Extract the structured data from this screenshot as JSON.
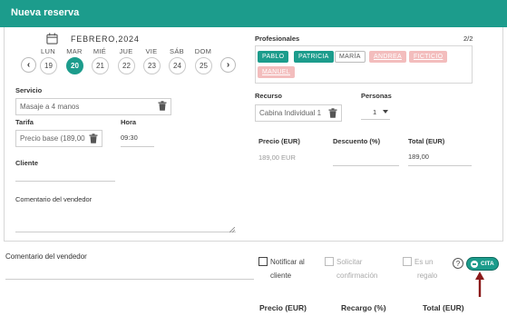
{
  "header": {
    "title": "Nueva reserva"
  },
  "calendar": {
    "month": "FEBRERO,2024",
    "prev": "‹",
    "next": "›",
    "days": [
      {
        "dow": "LUN",
        "num": "19",
        "selected": false
      },
      {
        "dow": "MAR",
        "num": "20",
        "selected": true
      },
      {
        "dow": "MIÉ",
        "num": "21",
        "selected": false
      },
      {
        "dow": "JUE",
        "num": "22",
        "selected": false
      },
      {
        "dow": "VIE",
        "num": "23",
        "selected": false
      },
      {
        "dow": "SÁB",
        "num": "24",
        "selected": false
      },
      {
        "dow": "DOM",
        "num": "25",
        "selected": false
      }
    ]
  },
  "form": {
    "servicio_label": "Servicio",
    "servicio_value": "Masaje a 4 manos",
    "tarifa_label": "Tarifa",
    "tarifa_value": "Precio base (189,00",
    "hora_label": "Hora",
    "hora_value": "09:30",
    "cliente_label": "Cliente",
    "comentario_label": "Comentario del vendedor"
  },
  "profesionales": {
    "label": "Profesionales",
    "count": "2/2",
    "chips": [
      {
        "name": "PABLO",
        "state": "on"
      },
      {
        "name": "PATRICIA",
        "state": "on"
      },
      {
        "name": "MARÍA",
        "state": "off"
      },
      {
        "name": "ANDREA",
        "state": "pink"
      },
      {
        "name": "FICTICIO",
        "state": "pink"
      },
      {
        "name": "MANUEL",
        "state": "pink"
      }
    ]
  },
  "recurso": {
    "label": "Recurso",
    "value": "Cabina Individual 1"
  },
  "personas": {
    "label": "Personas",
    "value": "1"
  },
  "pricing": {
    "precio_label": "Precio (EUR)",
    "precio_value": "189,00 EUR",
    "descuento_label": "Descuento (%)",
    "total_label": "Total (EUR)",
    "total_value": "189,00"
  },
  "bottom": {
    "comentario_label": "Comentario del vendedor",
    "notificar_line1": "Notificar al",
    "notificar_line2": "cliente",
    "solicitar_line1": "Solicitar",
    "solicitar_line2": "confirmación",
    "regalo_line1": "Es un",
    "regalo_line2": "regalo",
    "help": "?",
    "cita_label": "CITA"
  },
  "footer": {
    "precio_label": "Precio (EUR)",
    "recargo_label": "Recargo (%)",
    "total_label": "Total (EUR)"
  },
  "colors": {
    "accent": "#1c9c8c",
    "pink": "#f3bdbd",
    "arrow": "#8b1a1a"
  },
  "icons": [
    "calendar-icon",
    "trash-icon",
    "chevron-left-icon",
    "chevron-right-icon",
    "caret-down-icon",
    "help-icon",
    "minus-circle-icon",
    "arrow-up-icon",
    "resize-handle-icon"
  ]
}
